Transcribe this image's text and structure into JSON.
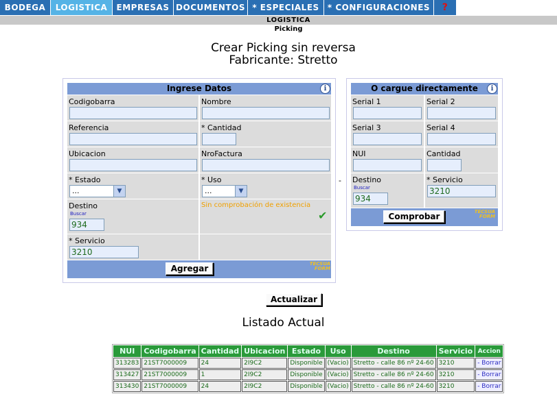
{
  "nav": {
    "tabs": [
      {
        "label": "BODEGA"
      },
      {
        "label": "LOGISTICA"
      },
      {
        "label": "EMPRESAS"
      },
      {
        "label": "DOCUMENTOS"
      },
      {
        "label": "* ESPECIALES"
      },
      {
        "label": "* CONFIGURACIONES"
      },
      {
        "label": "?"
      }
    ],
    "active": "LOGISTICA"
  },
  "section": {
    "title": "LOGISTICA",
    "subtitle": "Picking"
  },
  "page": {
    "title": "Crear Picking sin reversa",
    "manufacturer": "Fabricante: Stretto"
  },
  "form": {
    "header": "Ingrese Datos",
    "codigobarra_label": "Codigobarra",
    "nombre_label": "Nombre",
    "referencia_label": "Referencia",
    "cantidad_label": "* Cantidad",
    "ubicacion_label": "Ubicacion",
    "nrofactura_label": "NroFactura",
    "estado_label": "* Estado",
    "estado_value": "...",
    "uso_label": "* Uso",
    "uso_value": "...",
    "destino_label": "Destino",
    "buscar_label": "Buscar",
    "destino_value": "934",
    "existencia_text": "Sin comprobación de existencia",
    "servicio_label": "* Servicio",
    "servicio_value": "3210",
    "agregar_label": "Agregar",
    "logo_text": "TECSUA FORM"
  },
  "quick": {
    "header": "O cargue directamente",
    "serial1_label": "Serial 1",
    "serial2_label": "Serial 2",
    "serial3_label": "Serial 3",
    "serial4_label": "Serial 4",
    "nui_label": "NUI",
    "cantidad_label": "Cantidad",
    "destino_label": "Destino",
    "buscar_label": "Buscar",
    "destino_value": "934",
    "servicio_label": "* Servicio",
    "servicio_value": "3210",
    "comprobar_label": "Comprobar",
    "logo_text": "TECSUA FORM",
    "separator": "-"
  },
  "actualizar_label": "Actualizar",
  "listado": {
    "title": "Listado Actual",
    "columns": [
      "NUI",
      "Codigobarra",
      "Cantidad",
      "Ubicacion",
      "Estado",
      "Uso",
      "Destino",
      "Servicio",
      "Accion"
    ],
    "rows": [
      [
        "313283",
        "21ST7000009",
        "24",
        "2I9C2",
        "Disponible",
        "(Vacio)",
        "Stretto - calle 86 nº 24-60",
        "3210",
        "- Borrar"
      ],
      [
        "313427",
        "21ST7000009",
        "1",
        "2I9C2",
        "Disponible",
        "(Vacio)",
        "Stretto - calle 86 nº 24-60",
        "3210",
        "- Borrar"
      ],
      [
        "313430",
        "21ST7000009",
        "24",
        "2I9C2",
        "Disponible",
        "(Vacio)",
        "Stretto - calle 86 nº 24-60",
        "3210",
        "- Borrar"
      ]
    ]
  },
  "colors": {
    "nav": "#2a6fb3",
    "nav_active": "#55b3e6",
    "panel_header": "#7b9bd5",
    "table_header": "#2a9a3a"
  }
}
